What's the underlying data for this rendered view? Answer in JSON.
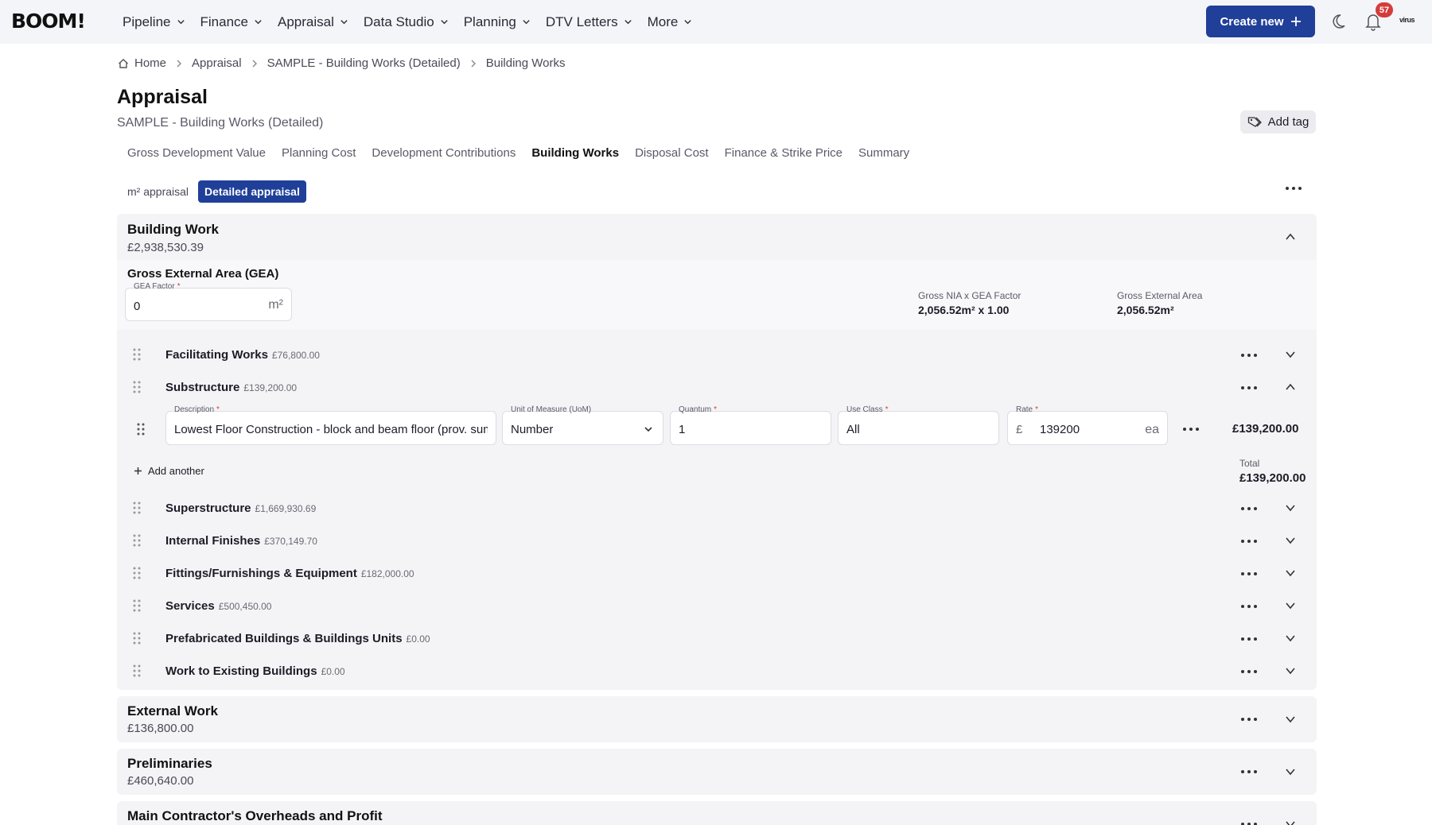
{
  "nav": {
    "logo": "BOOM!",
    "items": [
      "Pipeline",
      "Finance",
      "Appraisal",
      "Data Studio",
      "Planning",
      "DTV Letters",
      "More"
    ],
    "create_label": "Create new",
    "notifications_count": "57",
    "avatar_text": "virus",
    "accent_color": "#1f3f99",
    "icons": [
      "chevron-down-icon",
      "plus-icon",
      "moon-icon",
      "bell-icon"
    ]
  },
  "breadcrumb": [
    "Home",
    "Appraisal",
    "SAMPLE - Building Works (Detailed)",
    "Building Works"
  ],
  "page": {
    "title": "Appraisal",
    "subtitle": "SAMPLE - Building Works (Detailed)",
    "add_tag_label": "Add tag"
  },
  "tabs": [
    "Gross Development Value",
    "Planning Cost",
    "Development Contributions",
    "Building Works",
    "Disposal Cost",
    "Finance & Strike Price",
    "Summary"
  ],
  "active_tab": "Building Works",
  "toggle": {
    "option_1": "m² appraisal",
    "option_2": "Detailed appraisal",
    "selected": "Detailed appraisal"
  },
  "building_work": {
    "title": "Building Work",
    "amount": "£2,938,530.39",
    "gea": {
      "title": "Gross External Area (GEA)",
      "factor_label": "GEA Factor",
      "factor_value": "0",
      "factor_unit": "m²",
      "calc_label": "Gross NIA x GEA Factor",
      "calc_value": "2,056.52m² x 1.00",
      "area_label": "Gross External Area",
      "area_value": "2,056.52m²"
    },
    "sections": [
      {
        "label": "Facilitating Works",
        "amount": "£76,800.00"
      },
      {
        "label": "Substructure",
        "amount": "£139,200.00"
      },
      {
        "label": "Superstructure",
        "amount": "£1,669,930.69"
      },
      {
        "label": "Internal Finishes",
        "amount": "£370,149.70"
      },
      {
        "label": "Fittings/Furnishings & Equipment",
        "amount": "£182,000.00"
      },
      {
        "label": "Services",
        "amount": "£500,450.00"
      },
      {
        "label": "Prefabricated Buildings & Buildings Units",
        "amount": "£0.00"
      },
      {
        "label": "Work to Existing Buildings",
        "amount": "£0.00"
      }
    ],
    "line_item": {
      "description_label": "Description",
      "description_value": "Lowest Floor Construction - block and beam floor (prov. sum)",
      "uom_label": "Unit of Measure (UoM)",
      "uom_value": "Number",
      "quantum_label": "Quantum",
      "quantum_value": "1",
      "use_class_label": "Use Class",
      "use_class_value": "All",
      "rate_label": "Rate",
      "rate_currency": "£",
      "rate_value": "139200",
      "rate_unit": "ea",
      "line_total": "£139,200.00"
    },
    "add_another_label": "Add another",
    "total_label": "Total",
    "total_value": "£139,200.00"
  },
  "external_work": {
    "title": "External Work",
    "amount": "£136,800.00"
  },
  "preliminaries": {
    "title": "Preliminaries",
    "amount": "£460,640.00"
  },
  "main_contractor": {
    "title": "Main Contractor's Overheads and Profit"
  }
}
